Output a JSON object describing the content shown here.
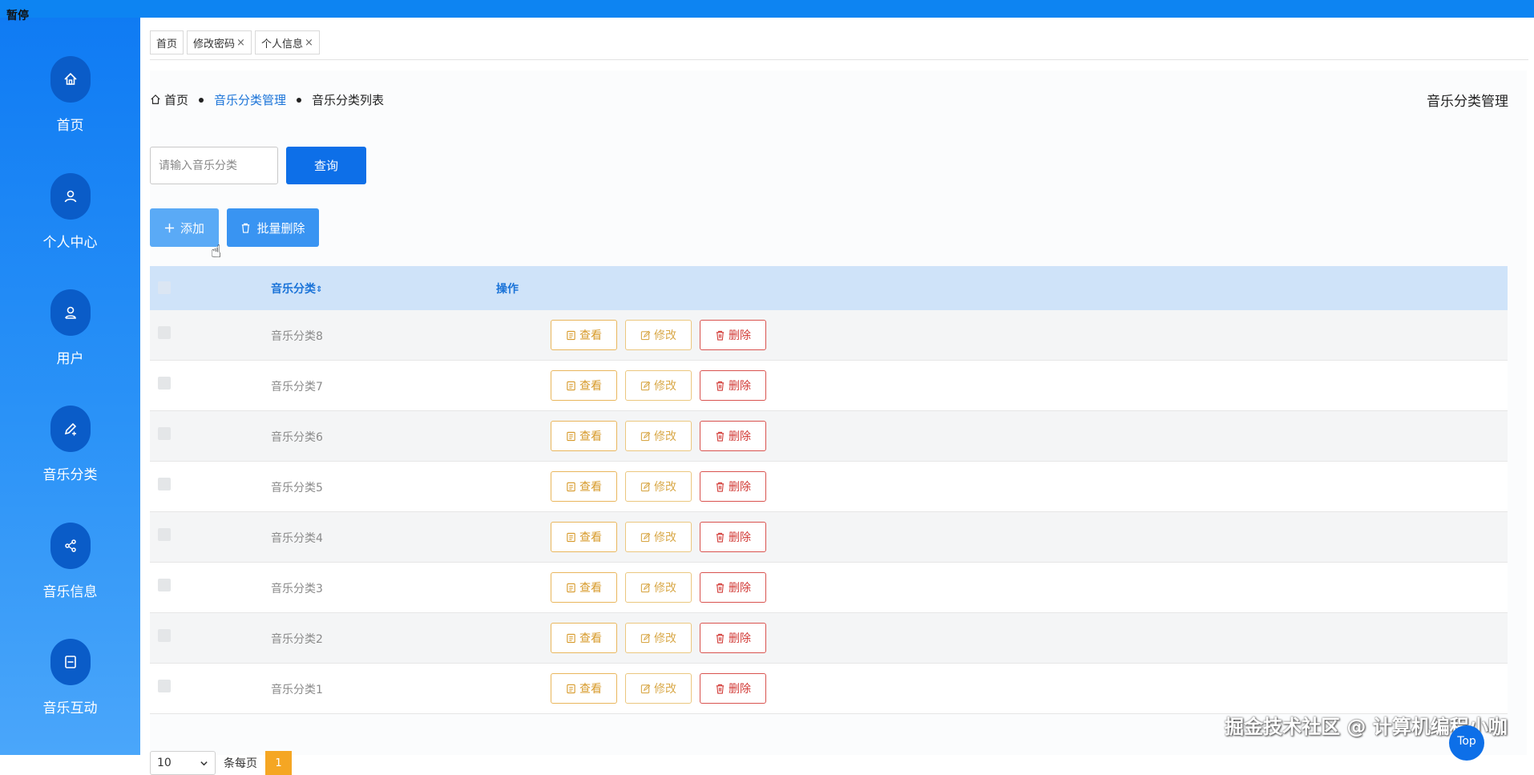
{
  "status": {
    "paused": "暂停"
  },
  "sidebar": {
    "items": [
      {
        "label": "首页",
        "icon": "home-icon"
      },
      {
        "label": "个人中心",
        "icon": "user-icon"
      },
      {
        "label": "用户",
        "icon": "person-icon"
      },
      {
        "label": "音乐分类",
        "icon": "edit-icon"
      },
      {
        "label": "音乐信息",
        "icon": "share-icon"
      },
      {
        "label": "音乐互动",
        "icon": "panel-icon"
      }
    ]
  },
  "tabs": [
    {
      "label": "首页",
      "closable": false
    },
    {
      "label": "修改密码",
      "closable": true
    },
    {
      "label": "个人信息",
      "closable": true
    }
  ],
  "tab_close": "×",
  "breadcrumb": {
    "home": "首页",
    "section": "音乐分类管理",
    "current": "音乐分类列表"
  },
  "page_title": "音乐分类管理",
  "search": {
    "placeholder": "请输入音乐分类",
    "button": "查询"
  },
  "actions": {
    "add": "添加",
    "batch_delete": "批量删除"
  },
  "table": {
    "headers": {
      "category": "音乐分类",
      "sort_icon": "⇕",
      "operations": "操作"
    },
    "rows": [
      {
        "name": "音乐分类8"
      },
      {
        "name": "音乐分类7"
      },
      {
        "name": "音乐分类6"
      },
      {
        "name": "音乐分类5"
      },
      {
        "name": "音乐分类4"
      },
      {
        "name": "音乐分类3"
      },
      {
        "name": "音乐分类2"
      },
      {
        "name": "音乐分类1"
      }
    ],
    "op_labels": {
      "view": "查看",
      "edit": "修改",
      "delete": "删除"
    }
  },
  "pagination": {
    "page_size": "10",
    "per_page_label": "条每页",
    "current_page": "1"
  },
  "watermark": "掘金技术社区 @ 计算机编程小咖",
  "top_button": "Top",
  "colors": {
    "primary": "#0d6fe8",
    "sidebar": "#0e7af3",
    "view": "#d79a2a",
    "edit": "#d9a94a",
    "delete": "#d23b37",
    "page_active": "#f5a623"
  }
}
